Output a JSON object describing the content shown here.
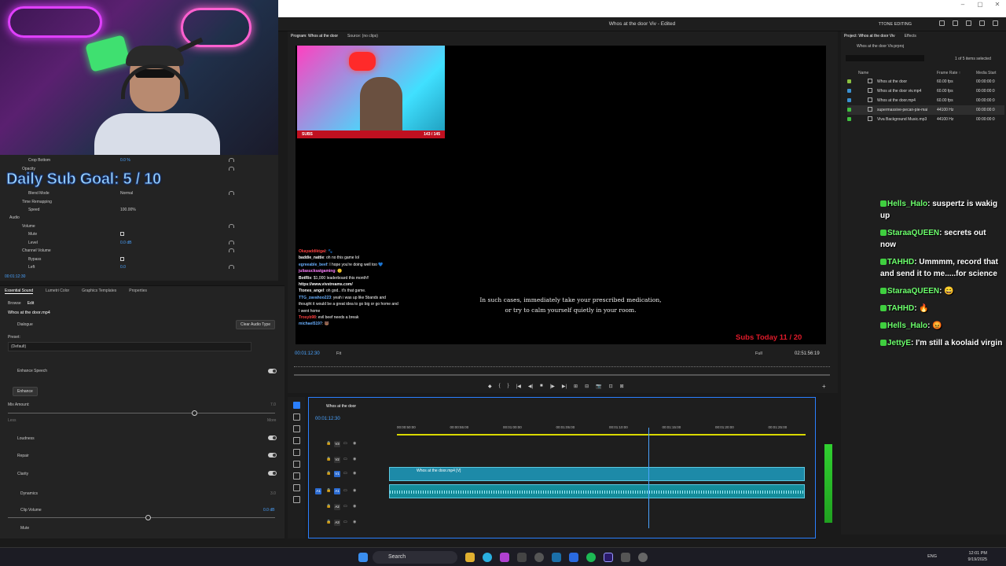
{
  "window": {
    "title": "Whos at the door Viv - Edited",
    "workspace": "TTONE EDITING",
    "controls": [
      "–",
      "▢",
      "✕"
    ]
  },
  "overlay": {
    "sub_goal": "Daily Sub Goal:  5 / 10",
    "subs_label": "SUBS",
    "subs_progress": "143 / 145",
    "subs_today": "Subs Today  11 / 20"
  },
  "effect_controls": {
    "rows": [
      {
        "label": "Crop Bottom",
        "value": "0.0 %"
      },
      {
        "label": "Opacity",
        "value": ""
      },
      {
        "label": "Blend Mode",
        "value": "Normal"
      },
      {
        "label": "Time Remapping",
        "value": ""
      },
      {
        "label": "Speed",
        "value": "100.00%"
      },
      {
        "label": "Audio",
        "value": ""
      },
      {
        "label": "Volume",
        "value": ""
      },
      {
        "label": "Mute",
        "value": ""
      },
      {
        "label": "Level",
        "value": "0.0 dB"
      },
      {
        "label": "Channel Volume",
        "value": ""
      },
      {
        "label": "Bypass",
        "value": ""
      },
      {
        "label": "Left",
        "value": "0.0"
      }
    ],
    "timecode": "00:01:12:30"
  },
  "essential_sound": {
    "tabs": [
      "Essential Sound",
      "Lumetri Color",
      "Graphics Templates",
      "Properties"
    ],
    "subtabs": [
      "Browse",
      "Edit"
    ],
    "clip_name": "Whos at the door.mp4",
    "type": "Dialogue",
    "clear_button": "Clear Audio Type",
    "preset_label": "Preset:",
    "preset_value": "(Default)",
    "enhance_speech": "Enhance Speech",
    "enhance_button": "Enhance",
    "mix_amount": "Mix Amount:",
    "mix_value": "7.0",
    "less": "Less",
    "more": "More",
    "loudness": "Loudness",
    "repair": "Repair",
    "clarity": "Clarity",
    "dynamics": "Dynamics",
    "dynamics_value": "3.0",
    "clip_volume": "Clip Volume",
    "clip_volume_value": "0.0 dB",
    "mute": "Mute"
  },
  "program_monitor": {
    "tabs": [
      "Program: Whos at the door",
      "Source: (no clips)"
    ],
    "caption_line1": "In such cases, immediately take your prescribed medication,",
    "caption_line2": "or try to calm yourself quietly in your room.",
    "timecode": "00:01:12:30",
    "fit": "Fit",
    "quality": "Full",
    "duration": "02:51:56:19",
    "transport": [
      "◆",
      "{",
      "}",
      "|◀",
      "◀|",
      "■",
      "|▶",
      "▶|",
      "⊞",
      "⊟",
      "📷",
      "⊡",
      "⊠"
    ],
    "add": "+"
  },
  "stream_chat": [
    {
      "user": "Okayaddiktgal",
      "text": ": 🐾",
      "color": "#ff4040"
    },
    {
      "user": "baddie_nattie",
      "text": ": oh no this game lol",
      "color": "#ffffff"
    },
    {
      "user": "egreeable_beef",
      "text": ": I hope you're doing well too 💙",
      "color": "#6ab0ff"
    },
    {
      "user": "juliasucksatgaming",
      "text": ": 🙂",
      "color": "#ff80ff"
    },
    {
      "user": "BotRix",
      "text": ": $1,000 leaderboard this month!!",
      "color": "#ffffff"
    },
    {
      "user": "https://www.vivstreams.com/",
      "text": "",
      "color": "#ffffff"
    },
    {
      "user": "Ttones_angel",
      "text": ": oh god.. it's that game.",
      "color": "#ffffff"
    },
    {
      "user": "TTG_zavahoo223",
      "text": ": yeah i was up like 5bands and",
      "color": "#6ab0ff"
    },
    {
      "user": "",
      "text": "thought it would be a great idea to go big or go home and",
      "color": "#ffffff"
    },
    {
      "user": "",
      "text": "I went home",
      "color": "#ffffff"
    },
    {
      "user": "Trosyb98",
      "text": ": evil beef needs a break",
      "color": "#ff4040"
    },
    {
      "user": "michael5197",
      "text": ": 🐻",
      "color": "#6ab0ff"
    }
  ],
  "project_panel": {
    "tabs": [
      "Project: Whos at the door Viv",
      "Effects"
    ],
    "file": "Whos at the door Viv.prproj",
    "count": "1 of 5 items selected",
    "columns": [
      "Name",
      "Frame Rate ↑",
      "Media Start"
    ],
    "items": [
      {
        "name": "Whos at the door",
        "fps": "60.00 fps",
        "start": "00:00:00:0",
        "color": "#8ac040"
      },
      {
        "name": "Whos at the door viv.mp4",
        "fps": "60.00 fps",
        "start": "00:00:00:0",
        "color": "#3a90d0"
      },
      {
        "name": "Whos at the door.mp4",
        "fps": "60.00 fps",
        "start": "00:00:00:0",
        "color": "#3a90d0"
      },
      {
        "name": "supermassive-pecan-pie-mai",
        "fps": "44100 Hz",
        "start": "00:00:00:0",
        "color": "#40c040"
      },
      {
        "name": "Viva Background Music.mp3",
        "fps": "44100 Hz",
        "start": "00:00:00:0",
        "color": "#40c040"
      }
    ]
  },
  "overlay_chat": [
    {
      "user": "Hells_Halo",
      "text": ": suspertz is wakig up"
    },
    {
      "user": "StaraaQUEEN",
      "text": ": secrets out now"
    },
    {
      "user": "TAHHD",
      "text": ": Ummmm, record that and send it to me.....for science"
    },
    {
      "user": "StaraaQUEEN",
      "text": ": 😄"
    },
    {
      "user": "TAHHD",
      "text": ": 🔥"
    },
    {
      "user": "Hells_Halo",
      "text": ": 😡"
    },
    {
      "user": "JettyE",
      "text": ": I'm still a koolaid virgin"
    }
  ],
  "timeline": {
    "sequence": "Whos at the door",
    "timecode": "00:01:12:30",
    "ticks": [
      "00:00:50:00",
      "00:00:55:00",
      "00:01:00:00",
      "00:01:05:00",
      "00:01:10:00",
      "00:01:15:00",
      "00:01:20:00",
      "00:01:25:00"
    ],
    "tracks": [
      "V3",
      "V2",
      "V1",
      "A1",
      "A2",
      "A3"
    ],
    "source_patch": "A1",
    "video_clip": "Whos at the door.mp4 [V]"
  },
  "taskbar": {
    "search": "Search",
    "lang": "ENG",
    "time": "12:01 PM",
    "date": "9/19/2025"
  }
}
